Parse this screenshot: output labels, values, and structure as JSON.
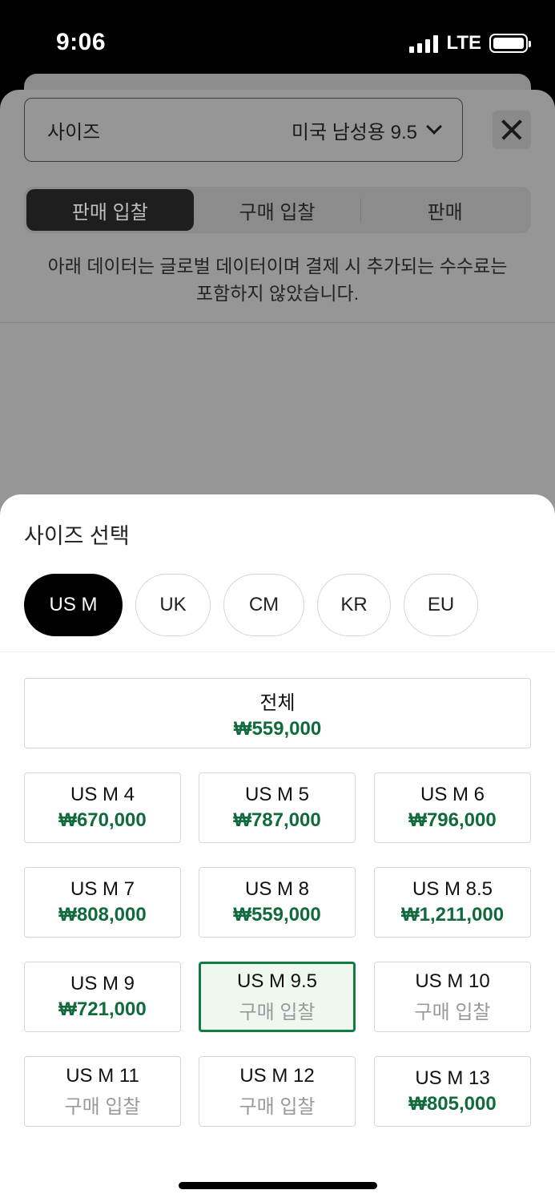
{
  "status_bar": {
    "time": "9:06",
    "network": "LTE"
  },
  "background": {
    "size_select": {
      "label": "사이즈",
      "value": "미국 남성용 9.5"
    },
    "segments": [
      {
        "label": "판매 입찰",
        "active": true
      },
      {
        "label": "구매 입찰",
        "active": false
      },
      {
        "label": "판매",
        "active": false
      }
    ],
    "note_line1": "아래 데이터는 글로벌 데이터이며 결제 시 추가되는 수수료는",
    "note_line2": "포함하지 않았습니다."
  },
  "picker": {
    "title": "사이즈 선택",
    "unit_tabs": [
      {
        "label": "US M",
        "active": true
      },
      {
        "label": "UK",
        "active": false
      },
      {
        "label": "CM",
        "active": false
      },
      {
        "label": "KR",
        "active": false
      },
      {
        "label": "EU",
        "active": false
      }
    ],
    "all": {
      "label": "전체",
      "price": "₩559,000"
    },
    "sizes": [
      {
        "label": "US M 4",
        "price": "₩670,000",
        "has_price": true,
        "selected": false
      },
      {
        "label": "US M 5",
        "price": "₩787,000",
        "has_price": true,
        "selected": false
      },
      {
        "label": "US M 6",
        "price": "₩796,000",
        "has_price": true,
        "selected": false
      },
      {
        "label": "US M 7",
        "price": "₩808,000",
        "has_price": true,
        "selected": false
      },
      {
        "label": "US M 8",
        "price": "₩559,000",
        "has_price": true,
        "selected": false
      },
      {
        "label": "US M 8.5",
        "price": "₩1,211,000",
        "has_price": true,
        "selected": false
      },
      {
        "label": "US M 9",
        "price": "₩721,000",
        "has_price": true,
        "selected": false
      },
      {
        "label": "US M 9.5",
        "price": "구매 입찰",
        "has_price": false,
        "selected": true
      },
      {
        "label": "US M 10",
        "price": "구매 입찰",
        "has_price": false,
        "selected": false
      },
      {
        "label": "US M 11",
        "price": "구매 입찰",
        "has_price": false,
        "selected": false
      },
      {
        "label": "US M 12",
        "price": "구매 입찰",
        "has_price": false,
        "selected": false
      },
      {
        "label": "US M 13",
        "price": "₩805,000",
        "has_price": true,
        "selected": false
      }
    ]
  },
  "colors": {
    "price_green": "#106a3c",
    "selected_border": "#137a43",
    "selected_fill": "#eef8ef"
  }
}
